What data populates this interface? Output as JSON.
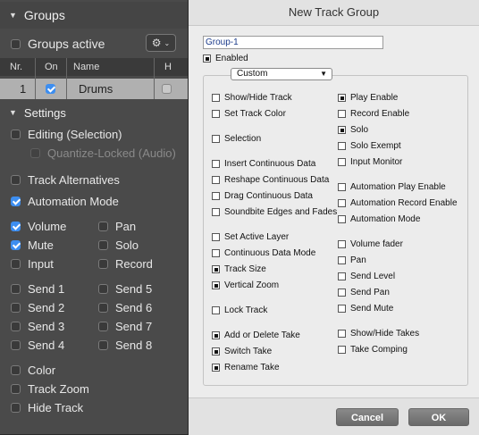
{
  "left": {
    "groups_header": "Groups",
    "groups_active": "Groups active",
    "columns": {
      "nr": "Nr.",
      "on": "On",
      "name": "Name",
      "h": "H"
    },
    "track": {
      "nr": "1",
      "name": "Drums"
    },
    "settings_header": "Settings",
    "editing": "Editing (Selection)",
    "quantize": "Quantize-Locked (Audio)",
    "track_alternatives": "Track Alternatives",
    "automation_mode": "Automation Mode",
    "volume": "Volume",
    "pan": "Pan",
    "mute": "Mute",
    "solo": "Solo",
    "input": "Input",
    "record": "Record",
    "send1": "Send 1",
    "send2": "Send 2",
    "send3": "Send 3",
    "send4": "Send 4",
    "send5": "Send 5",
    "send6": "Send 6",
    "send7": "Send 7",
    "send8": "Send 8",
    "color": "Color",
    "track_zoom": "Track Zoom",
    "hide_track": "Hide Track"
  },
  "dialog": {
    "title": "New Track Group",
    "name_value": "Group-1",
    "enabled": "Enabled",
    "preset": "Custom",
    "left_options": [
      {
        "label": "Show/Hide Track",
        "checked": false
      },
      {
        "label": "Set Track Color",
        "checked": false
      },
      {
        "label": "Selection",
        "checked": false
      },
      {
        "label": "Insert Continuous Data",
        "checked": false
      },
      {
        "label": "Reshape Continuous Data",
        "checked": false
      },
      {
        "label": "Drag Continuous Data",
        "checked": false
      },
      {
        "label": "Soundbite Edges and Fades",
        "checked": false
      },
      {
        "label": "Set Active Layer",
        "checked": false
      },
      {
        "label": "Continuous Data Mode",
        "checked": false
      },
      {
        "label": "Track Size",
        "checked": true
      },
      {
        "label": "Vertical Zoom",
        "checked": true
      },
      {
        "label": "Lock Track",
        "checked": false
      },
      {
        "label": "Add or Delete Take",
        "checked": true
      },
      {
        "label": "Switch Take",
        "checked": true
      },
      {
        "label": "Rename Take",
        "checked": true
      }
    ],
    "right_options": [
      {
        "label": "Play Enable",
        "checked": true
      },
      {
        "label": "Record Enable",
        "checked": false
      },
      {
        "label": "Solo",
        "checked": true
      },
      {
        "label": "Solo Exempt",
        "checked": false
      },
      {
        "label": "Input Monitor",
        "checked": false
      },
      {
        "label": "Automation Play Enable",
        "checked": false
      },
      {
        "label": "Automation Record Enable",
        "checked": false
      },
      {
        "label": "Automation Mode",
        "checked": false
      },
      {
        "label": "Volume fader",
        "checked": false
      },
      {
        "label": "Pan",
        "checked": false
      },
      {
        "label": "Send Level",
        "checked": false
      },
      {
        "label": "Send Pan",
        "checked": false
      },
      {
        "label": "Send Mute",
        "checked": false
      },
      {
        "label": "Show/Hide Takes",
        "checked": false
      },
      {
        "label": "Take Comping",
        "checked": false
      }
    ],
    "cancel": "Cancel",
    "ok": "OK"
  }
}
